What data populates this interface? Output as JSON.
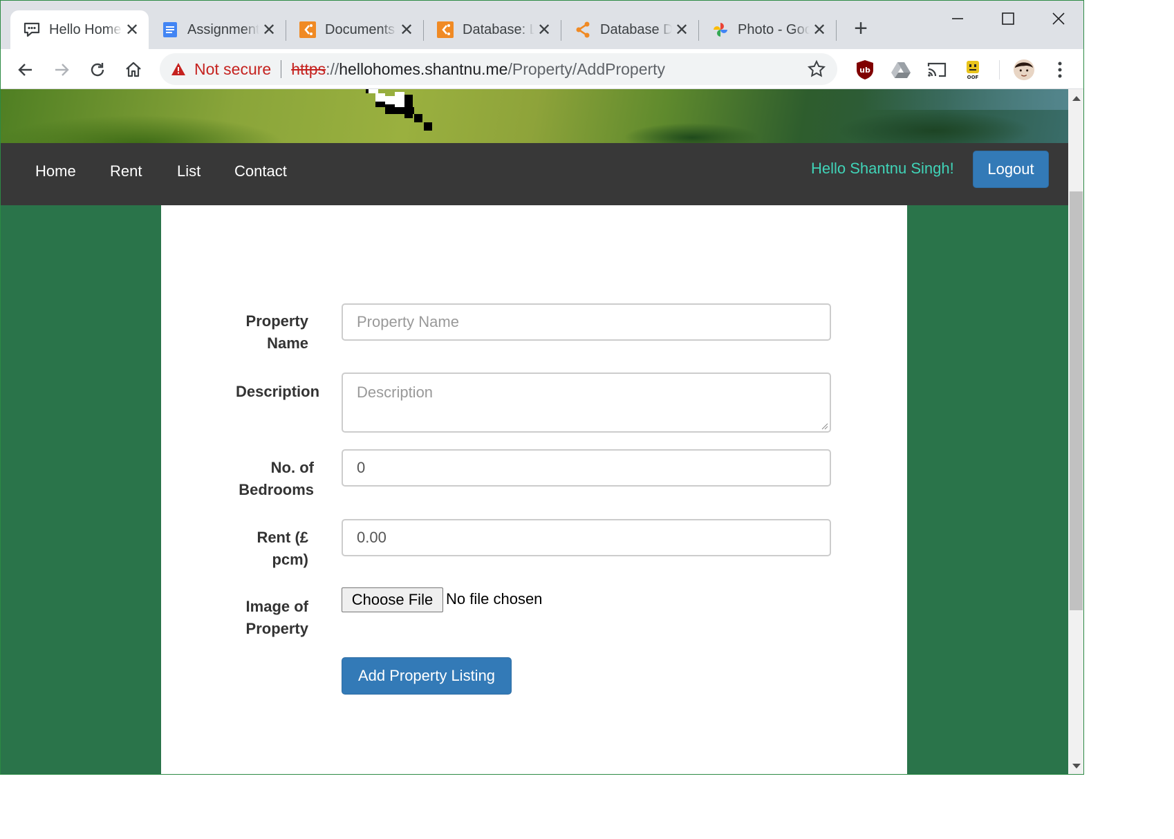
{
  "browser": {
    "tabs": [
      {
        "title": "Hello Homes",
        "icon": "chat-bubble-icon",
        "active": true
      },
      {
        "title": "Assignment",
        "icon": "google-docs-icon",
        "active": false
      },
      {
        "title": "Documents",
        "icon": "orange-grid-icon",
        "active": false
      },
      {
        "title": "Database: L",
        "icon": "orange-grid-icon",
        "active": false
      },
      {
        "title": "Database Design",
        "icon": "share-nodes-icon",
        "active": false
      },
      {
        "title": "Photo - Google",
        "icon": "pinwheel-icon",
        "active": false
      }
    ],
    "new_tab": "+",
    "close_glyph": "✕",
    "address": {
      "security": "Not secure",
      "scheme": "https",
      "separator": "://",
      "host": "hellohomes.shantnu.me",
      "path": "/Property/AddProperty"
    }
  },
  "site": {
    "nav": [
      "Home",
      "Rent",
      "List",
      "Contact"
    ],
    "greeting": "Hello Shantnu Singh!",
    "logout": "Logout"
  },
  "form": {
    "property_name": {
      "label": "Property Name",
      "label_lines": [
        "Property",
        "Name"
      ],
      "placeholder": "Property Name",
      "value": ""
    },
    "description": {
      "label": "Description",
      "placeholder": "Description",
      "value": ""
    },
    "bedrooms": {
      "label_lines": [
        "No. of",
        "Bedrooms"
      ],
      "value": "0"
    },
    "rent": {
      "label_lines": [
        "Rent (£",
        "pcm)"
      ],
      "value": "0.00"
    },
    "image": {
      "label_lines": [
        "Image of",
        "Property"
      ],
      "button": "Choose File",
      "status": "No file chosen"
    },
    "submit": "Add Property Listing"
  },
  "colors": {
    "page_bg": "#2a744a",
    "navbar_bg": "#383838",
    "primary": "#337ab7",
    "greeting": "#40d4b8",
    "not_secure": "#c5221f"
  }
}
